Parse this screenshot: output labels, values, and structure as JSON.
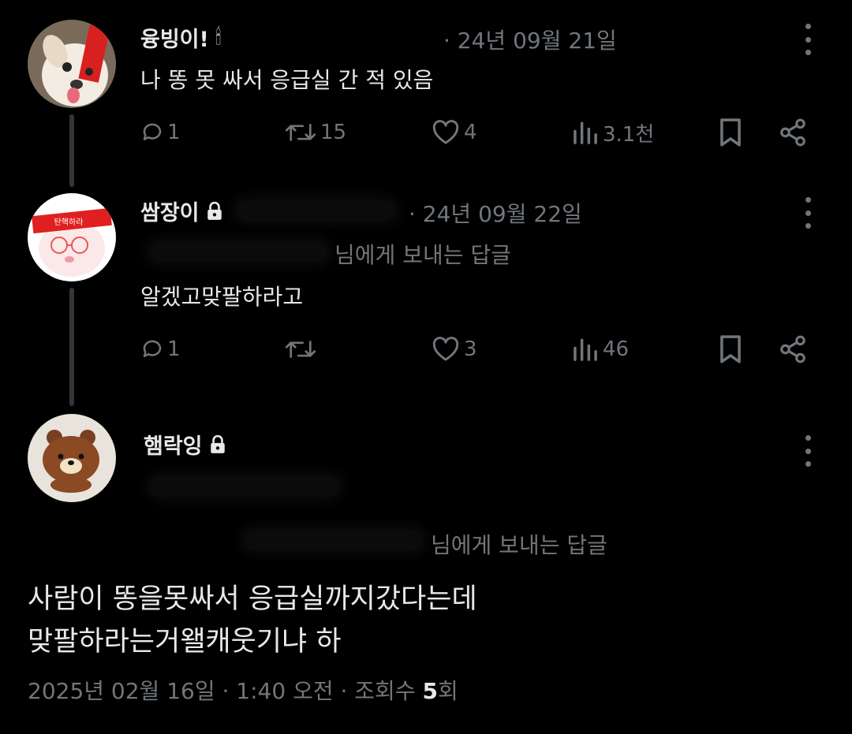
{
  "tweets": [
    {
      "name": "융빙이!",
      "name_emoji": "🕯",
      "date": "· 24년 09월 21일",
      "text": "나 똥 못 싸서 응급실 간 적 있음",
      "replies": "1",
      "retweets": "15",
      "likes": "4",
      "views": "3.1천"
    },
    {
      "name": "쌈장이",
      "locked": true,
      "date": "· 24년 09월 22일",
      "reply_to": "님에게 보내는 답글",
      "text": "알겠고맞팔하라고",
      "replies": "1",
      "retweets": "",
      "likes": "3",
      "views": "46"
    }
  ],
  "focused": {
    "name": "햄락잉",
    "locked": true,
    "reply_to": "님에게 보내는 답글",
    "text_line1": "사람이 똥을못싸서 응급실까지갔다는데",
    "text_line2": "맞팔하라는거왤캐웃기냐 하",
    "footer_prefix": "2025년 02월 16일 · 1:40 오전 · 조회수 ",
    "view_count": "5",
    "footer_suffix": "회"
  },
  "icons": {
    "reply": "reply-icon",
    "retweet": "retweet-icon",
    "like": "heart-icon",
    "views": "views-icon",
    "bookmark": "bookmark-icon",
    "share": "share-icon",
    "lock": "lock-icon",
    "more": "more-icon"
  },
  "colors": {
    "background": "#000000",
    "text": "#e7e9ea",
    "secondary": "#71767b",
    "thread_line": "#333639",
    "avatar_band": "#e02020"
  }
}
